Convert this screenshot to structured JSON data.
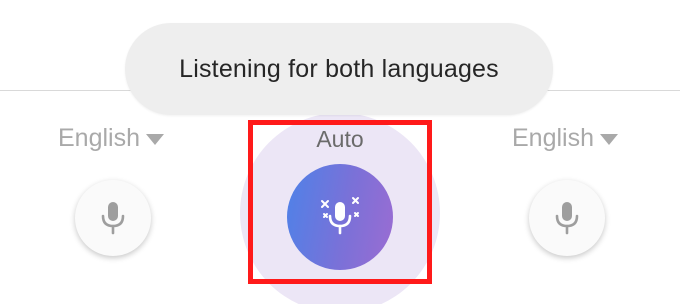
{
  "toast": {
    "text": "Listening for both languages"
  },
  "left_panel": {
    "language": "English",
    "caret_icon": "caret-down-icon",
    "mic_icon": "microphone-icon"
  },
  "center_panel": {
    "mode_label": "Auto",
    "mic_icon": "microphone-sparkle-icon"
  },
  "right_panel": {
    "language": "English",
    "caret_icon": "caret-down-icon",
    "mic_icon": "microphone-icon"
  },
  "colors": {
    "halo": "#ece6f6",
    "mic_gradient_start": "#4e82e8",
    "mic_gradient_end": "#9b6cd2",
    "highlight": "#ff1a1a",
    "inactive_text": "#a9a9a9"
  }
}
